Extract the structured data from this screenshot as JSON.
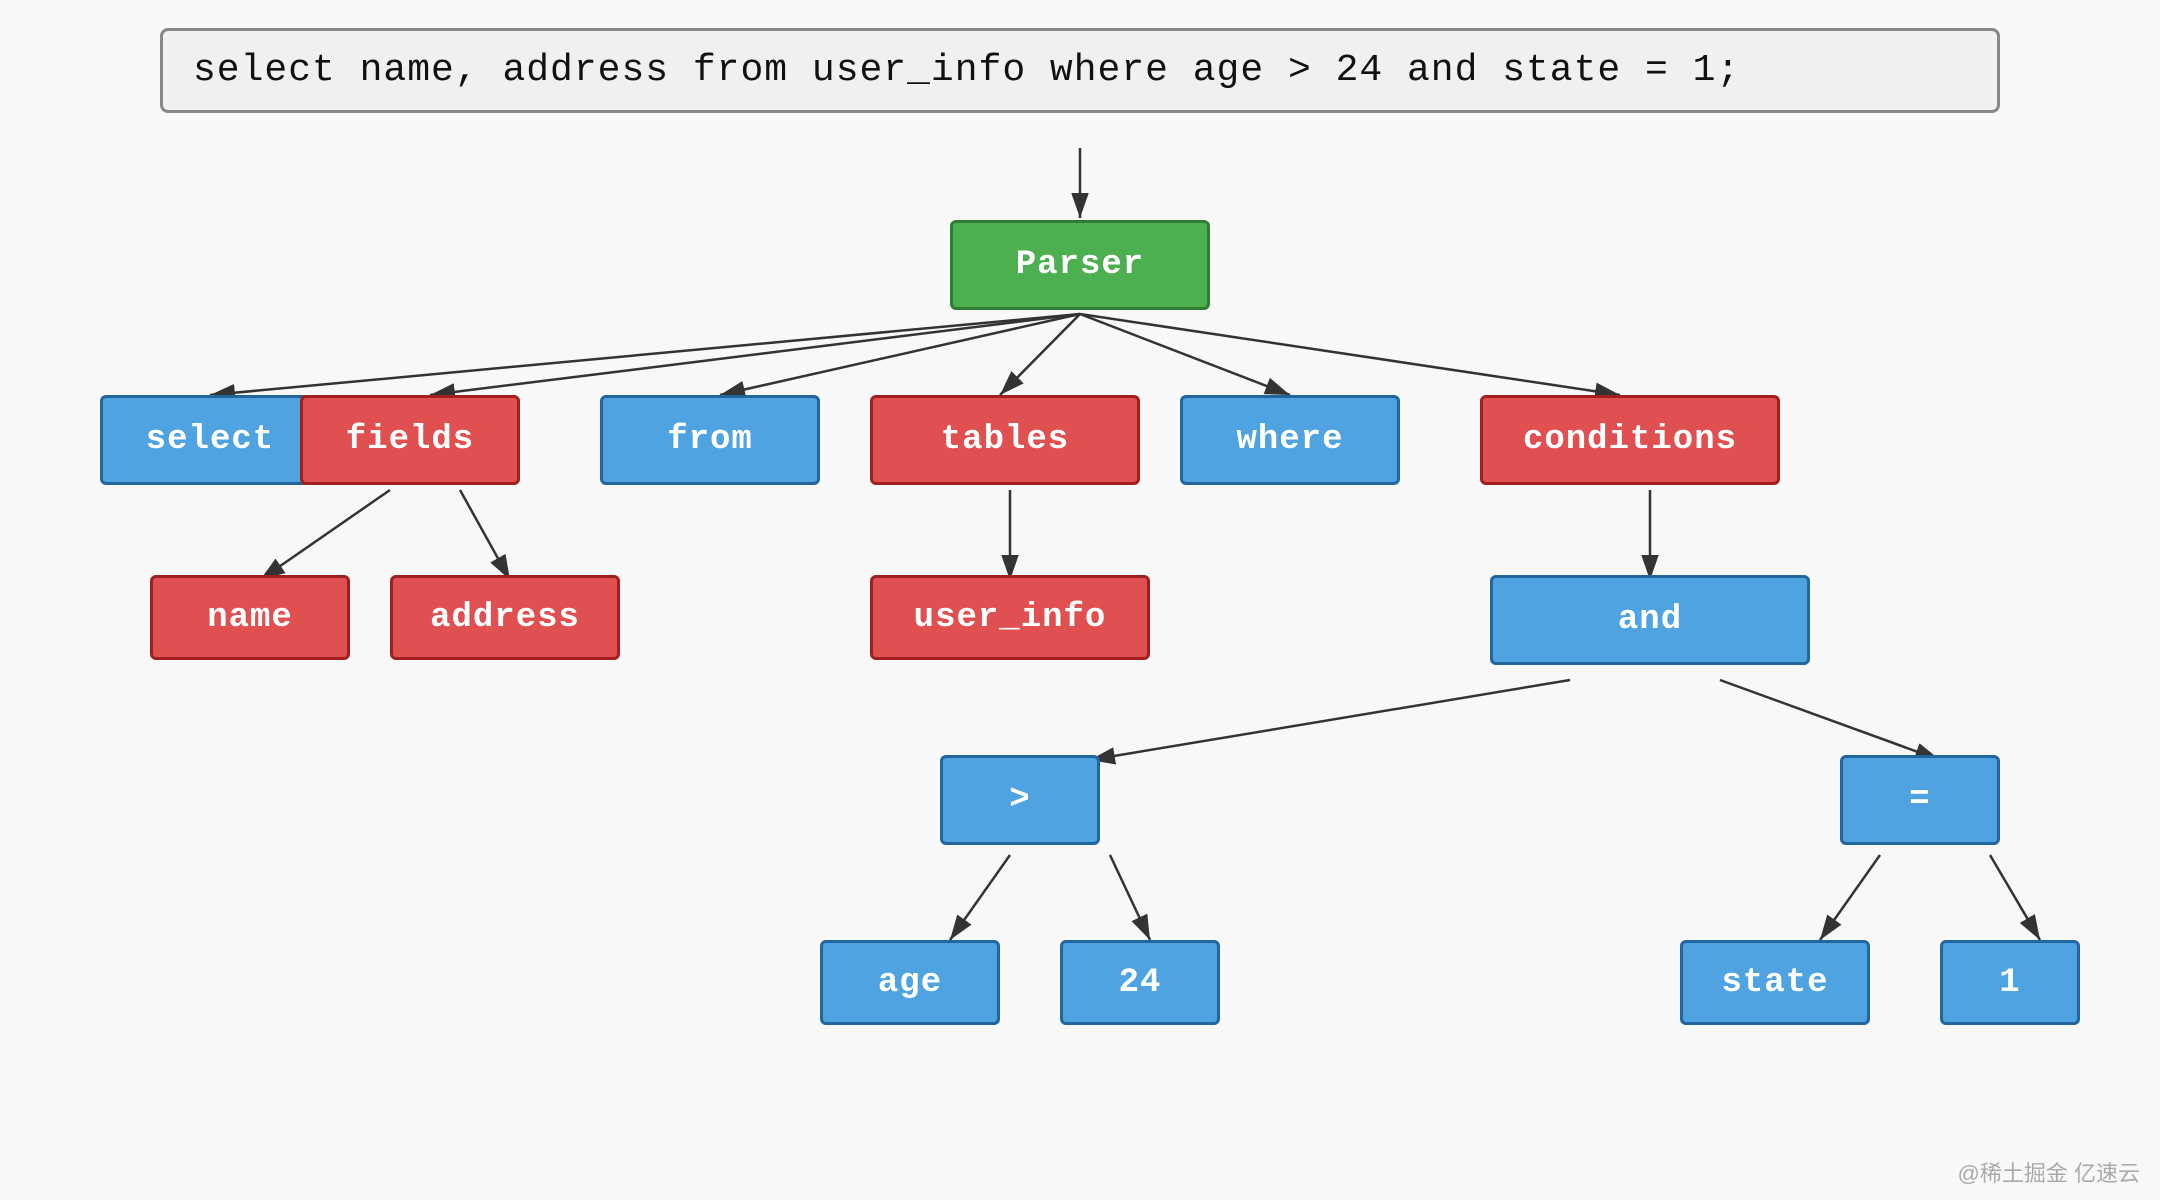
{
  "sql": {
    "text": "select name, address from user_info where age > 24 and state = 1;"
  },
  "nodes": {
    "parser": {
      "label": "Parser"
    },
    "select": {
      "label": "select"
    },
    "fields": {
      "label": "fields"
    },
    "from": {
      "label": "from"
    },
    "tables": {
      "label": "tables"
    },
    "where": {
      "label": "where"
    },
    "conditions": {
      "label": "conditions"
    },
    "name": {
      "label": "name"
    },
    "address": {
      "label": "address"
    },
    "user_info": {
      "label": "user_info"
    },
    "and": {
      "label": "and"
    },
    "gt": {
      "label": ">"
    },
    "eq": {
      "label": "="
    },
    "age": {
      "label": "age"
    },
    "n24": {
      "label": "24"
    },
    "state": {
      "label": "state"
    },
    "n1": {
      "label": "1"
    }
  },
  "watermark": "@稀土掘金  亿速云"
}
